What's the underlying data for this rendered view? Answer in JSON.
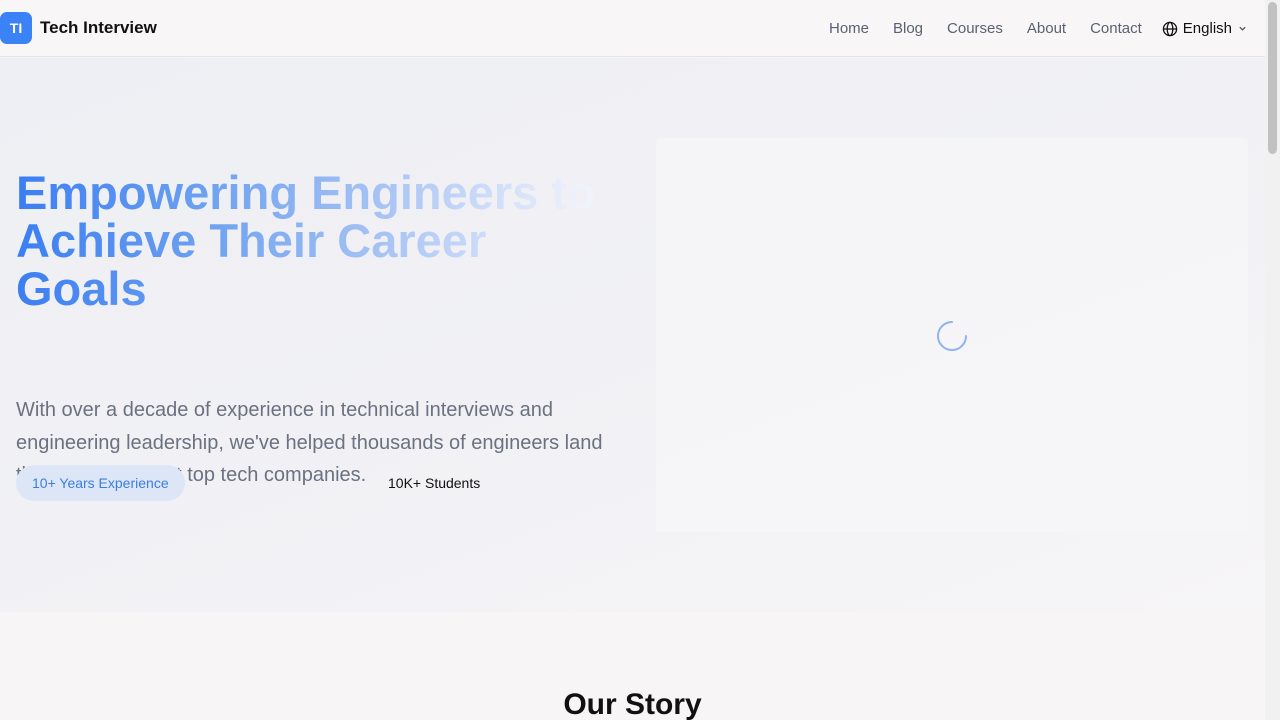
{
  "nav": {
    "logo_initials": "TI",
    "brand": "Tech Interview",
    "links": [
      "Home",
      "Blog",
      "Courses",
      "About",
      "Contact"
    ],
    "language": "English"
  },
  "hero": {
    "title": "Empowering Engineers to Achieve Their Career Goals",
    "description": "With over a decade of experience in technical interviews and engineering leadership, we've helped thousands of engineers land their dream jobs at top tech companies.",
    "badge_experience": "10+ Years Experience",
    "stat_students": "10K+ Students",
    "visual_state": "loading-spinner"
  },
  "story": {
    "title": "Our Story"
  },
  "colors": {
    "accent": "#3b82f6",
    "badge_bg": "#dde6f7",
    "badge_text": "#3b7ee0"
  },
  "icons": [
    "globe-icon",
    "chevron-down-icon",
    "loading-spinner-icon"
  ]
}
